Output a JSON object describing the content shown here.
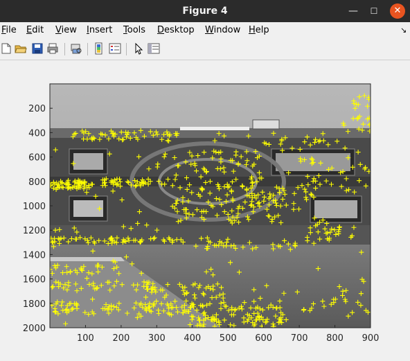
{
  "window": {
    "title": "Figure 4"
  },
  "menubar": {
    "items": [
      {
        "key": "F",
        "rest": "ile"
      },
      {
        "key": "E",
        "rest": "dit"
      },
      {
        "key": "V",
        "rest": "iew"
      },
      {
        "key": "I",
        "rest": "nsert"
      },
      {
        "key": "T",
        "rest": "ools"
      },
      {
        "key": "D",
        "rest": "esktop"
      },
      {
        "key": "W",
        "rest": "indow"
      },
      {
        "key": "H",
        "rest": "elp"
      }
    ]
  },
  "toolbar": {
    "icons": [
      "new-figure-icon",
      "open-file-icon",
      "save-icon",
      "print-icon",
      "print-preview-icon",
      "colorbar-icon",
      "legend-icon",
      "pointer-icon",
      "property-inspector-icon"
    ]
  },
  "chart_data": {
    "type": "scatter",
    "title": "",
    "xlabel": "",
    "ylabel": "",
    "xlim": [
      0,
      900
    ],
    "ylim": [
      2000,
      0
    ],
    "xticks": [
      100,
      200,
      300,
      400,
      500,
      600,
      700,
      800,
      900
    ],
    "yticks": [
      200,
      400,
      600,
      800,
      1000,
      1200,
      1400,
      1600,
      1800,
      2000
    ],
    "marker": "+",
    "marker_color": "#ffff00",
    "background": "grayscale building photo",
    "feature_clusters": [
      {
        "x": [
          0,
          120
        ],
        "y": [
          790,
          860
        ],
        "n": 60
      },
      {
        "x": [
          130,
          320
        ],
        "y": [
          780,
          840
        ],
        "n": 40
      },
      {
        "x": [
          60,
          260
        ],
        "y": [
          380,
          460
        ],
        "n": 35
      },
      {
        "x": [
          260,
          380
        ],
        "y": [
          390,
          430
        ],
        "n": 12
      },
      {
        "x": [
          0,
          260
        ],
        "y": [
          1260,
          1310
        ],
        "n": 45
      },
      {
        "x": [
          280,
          460
        ],
        "y": [
          1260,
          1300
        ],
        "n": 15
      },
      {
        "x": [
          400,
          700
        ],
        "y": [
          1300,
          1360
        ],
        "n": 25
      },
      {
        "x": [
          300,
          600
        ],
        "y": [
          550,
          900
        ],
        "n": 80
      },
      {
        "x": [
          350,
          650
        ],
        "y": [
          900,
          1150
        ],
        "n": 70
      },
      {
        "x": [
          550,
          750
        ],
        "y": [
          850,
          1050
        ],
        "n": 30
      },
      {
        "x": [
          700,
          900
        ],
        "y": [
          600,
          900
        ],
        "n": 35
      },
      {
        "x": [
          820,
          900
        ],
        "y": [
          80,
          400
        ],
        "n": 25
      },
      {
        "x": [
          600,
          850
        ],
        "y": [
          400,
          550
        ],
        "n": 20
      },
      {
        "x": [
          720,
          820
        ],
        "y": [
          1100,
          1320
        ],
        "n": 25
      },
      {
        "x": [
          0,
          200
        ],
        "y": [
          1480,
          1560
        ],
        "n": 25
      },
      {
        "x": [
          0,
          300
        ],
        "y": [
          1620,
          1700
        ],
        "n": 40
      },
      {
        "x": [
          250,
          500
        ],
        "y": [
          1640,
          1760
        ],
        "n": 35
      },
      {
        "x": [
          0,
          400
        ],
        "y": [
          1800,
          1890
        ],
        "n": 80
      },
      {
        "x": [
          350,
          650
        ],
        "y": [
          1780,
          1950
        ],
        "n": 70
      },
      {
        "x": [
          380,
          680
        ],
        "y": [
          1930,
          1990
        ],
        "n": 40
      },
      {
        "x": [
          700,
          900
        ],
        "y": [
          1780,
          1880
        ],
        "n": 15
      },
      {
        "x": [
          0,
          900
        ],
        "y": [
          400,
          1990
        ],
        "n": 120
      }
    ]
  }
}
